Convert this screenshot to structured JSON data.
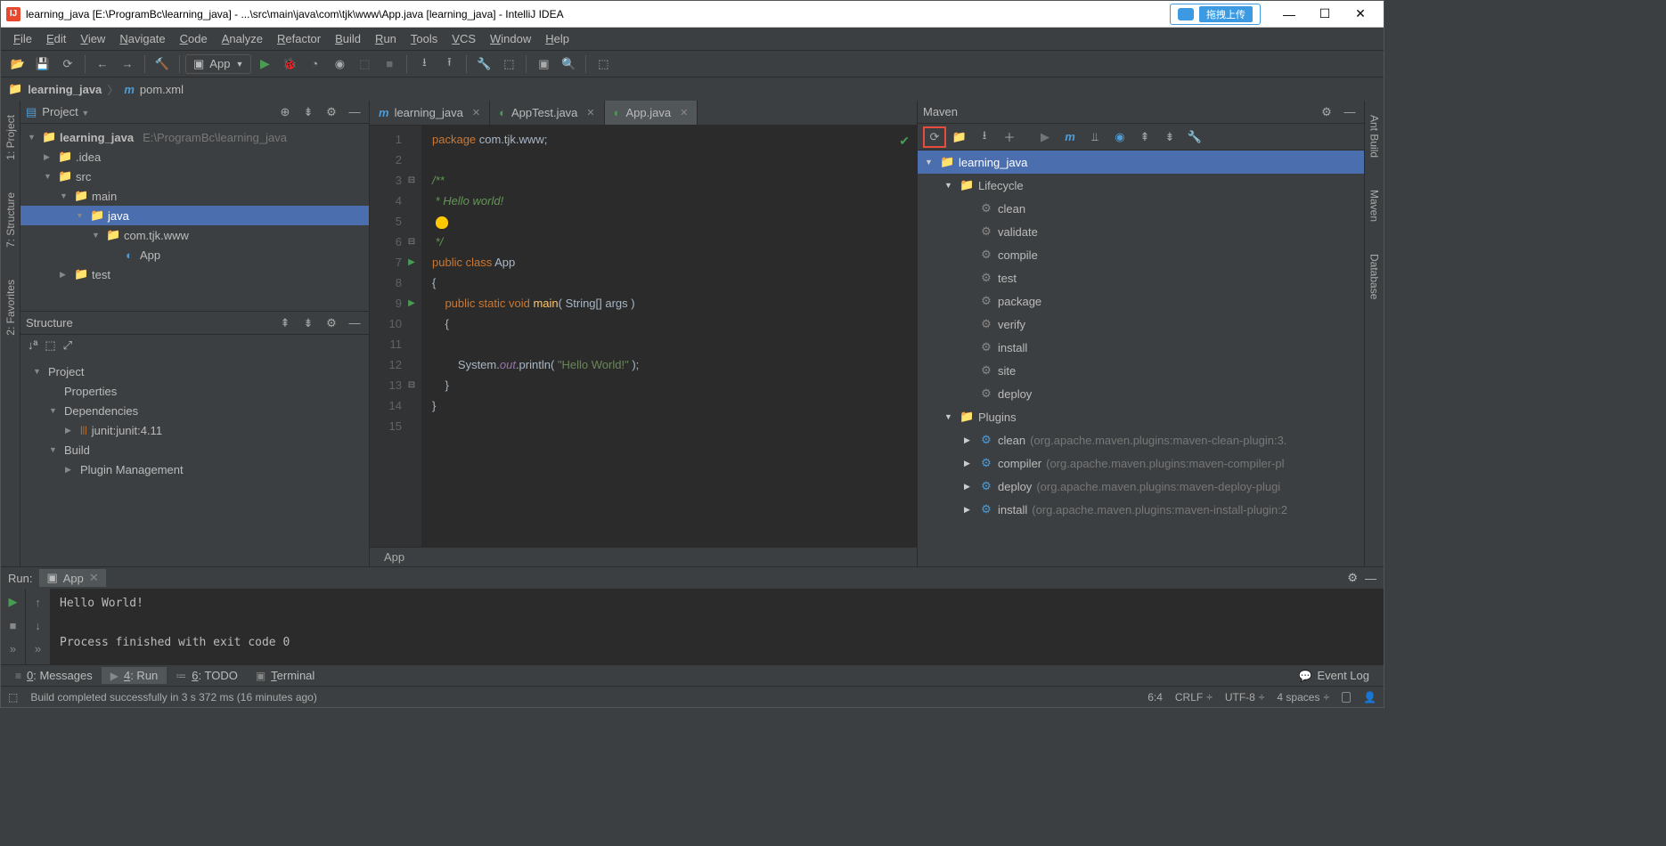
{
  "title": "learning_java [E:\\ProgramBc\\learning_java] - ...\\src\\main\\java\\com\\tjk\\www\\App.java [learning_java] - IntelliJ IDEA",
  "drag_upload": "拖拽上传",
  "menu": [
    "File",
    "Edit",
    "View",
    "Navigate",
    "Code",
    "Analyze",
    "Refactor",
    "Build",
    "Run",
    "Tools",
    "VCS",
    "Window",
    "Help"
  ],
  "run_config": "App",
  "breadcrumb": {
    "root": "learning_java",
    "file_icon": "m",
    "file": "pom.xml"
  },
  "left_strips": [
    "1: Project",
    "7: Structure",
    "2: Favorites"
  ],
  "right_strips": [
    "Ant Build",
    "Maven",
    "Database"
  ],
  "project_panel": {
    "title": "Project",
    "rows": [
      {
        "indent": 0,
        "arrow": "▼",
        "icon": "📁",
        "iconColor": "#4e9cd6",
        "label": "learning_java",
        "suffix": "E:\\ProgramBc\\learning_java",
        "bold": true
      },
      {
        "indent": 1,
        "arrow": "▶",
        "icon": "📁",
        "iconColor": "#888",
        "label": ".idea"
      },
      {
        "indent": 1,
        "arrow": "▼",
        "icon": "📁",
        "iconColor": "#888",
        "label": "src"
      },
      {
        "indent": 2,
        "arrow": "▼",
        "icon": "📁",
        "iconColor": "#888",
        "label": "main"
      },
      {
        "indent": 3,
        "arrow": "▼",
        "icon": "📁",
        "iconColor": "#4e9cd6",
        "label": "java",
        "sel": true
      },
      {
        "indent": 4,
        "arrow": "▼",
        "icon": "📁",
        "iconColor": "#888",
        "label": "com.tjk.www"
      },
      {
        "indent": 5,
        "arrow": "",
        "icon": "◐",
        "iconColor": "#4e9cd6",
        "label": "App"
      },
      {
        "indent": 2,
        "arrow": "▶",
        "icon": "📁",
        "iconColor": "#888",
        "label": "test"
      }
    ]
  },
  "structure_panel": {
    "title": "Structure",
    "rows": [
      {
        "indent": 0,
        "arrow": "▼",
        "label": "Project"
      },
      {
        "indent": 1,
        "arrow": "",
        "label": "Properties"
      },
      {
        "indent": 1,
        "arrow": "▼",
        "label": "Dependencies"
      },
      {
        "indent": 2,
        "arrow": "▶",
        "icon": "|||",
        "iconColor": "#cc7832",
        "label": "junit:junit:4.11"
      },
      {
        "indent": 1,
        "arrow": "▼",
        "label": "Build"
      },
      {
        "indent": 2,
        "arrow": "▶",
        "label": "Plugin Management"
      }
    ]
  },
  "tabs": [
    {
      "icon": "m",
      "iconColor": "#4e9cd6",
      "label": "learning_java"
    },
    {
      "icon": "◐",
      "iconColor": "#499c54",
      "label": "AppTest.java"
    },
    {
      "icon": "◐",
      "iconColor": "#499c54",
      "label": "App.java",
      "active": true
    }
  ],
  "gutter_lines": 15,
  "crumb2": "App",
  "maven": {
    "title": "Maven",
    "rows": [
      {
        "indent": 0,
        "arrow": "▼",
        "icon": "📁",
        "iconColor": "#4e9cd6",
        "label": "learning_java",
        "sel": true
      },
      {
        "indent": 1,
        "arrow": "▼",
        "icon": "📁",
        "iconColor": "#4e9cd6",
        "label": "Lifecycle"
      },
      {
        "indent": 2,
        "icon": "⚙",
        "label": "clean"
      },
      {
        "indent": 2,
        "icon": "⚙",
        "label": "validate"
      },
      {
        "indent": 2,
        "icon": "⚙",
        "label": "compile"
      },
      {
        "indent": 2,
        "icon": "⚙",
        "label": "test"
      },
      {
        "indent": 2,
        "icon": "⚙",
        "label": "package"
      },
      {
        "indent": 2,
        "icon": "⚙",
        "label": "verify"
      },
      {
        "indent": 2,
        "icon": "⚙",
        "label": "install"
      },
      {
        "indent": 2,
        "icon": "⚙",
        "label": "site"
      },
      {
        "indent": 2,
        "icon": "⚙",
        "label": "deploy"
      },
      {
        "indent": 1,
        "arrow": "▼",
        "icon": "📁",
        "iconColor": "#4e9cd6",
        "label": "Plugins"
      },
      {
        "indent": 2,
        "arrow": "▶",
        "icon": "⚙",
        "iconColor": "#4e9cd6",
        "label": "clean",
        "suffix": "(org.apache.maven.plugins:maven-clean-plugin:3."
      },
      {
        "indent": 2,
        "arrow": "▶",
        "icon": "⚙",
        "iconColor": "#4e9cd6",
        "label": "compiler",
        "suffix": "(org.apache.maven.plugins:maven-compiler-pl"
      },
      {
        "indent": 2,
        "arrow": "▶",
        "icon": "⚙",
        "iconColor": "#4e9cd6",
        "label": "deploy",
        "suffix": "(org.apache.maven.plugins:maven-deploy-plugi"
      },
      {
        "indent": 2,
        "arrow": "▶",
        "icon": "⚙",
        "iconColor": "#4e9cd6",
        "label": "install",
        "suffix": "(org.apache.maven.plugins:maven-install-plugin:2"
      }
    ]
  },
  "run": {
    "label": "Run:",
    "tab": "App",
    "console": "Hello World!\n\nProcess finished with exit code 0"
  },
  "bottom_tabs": [
    {
      "icon": "≡",
      "label": "0: Messages"
    },
    {
      "icon": "▶",
      "label": "4: Run",
      "active": true
    },
    {
      "icon": "≔",
      "label": "6: TODO"
    },
    {
      "icon": "▣",
      "label": "Terminal"
    }
  ],
  "event_log": "Event Log",
  "status": {
    "msg": "Build completed successfully in 3 s 372 ms (16 minutes ago)",
    "pos": "6:4",
    "crlf": "CRLF",
    "enc": "UTF-8",
    "indent": "4 spaces"
  }
}
